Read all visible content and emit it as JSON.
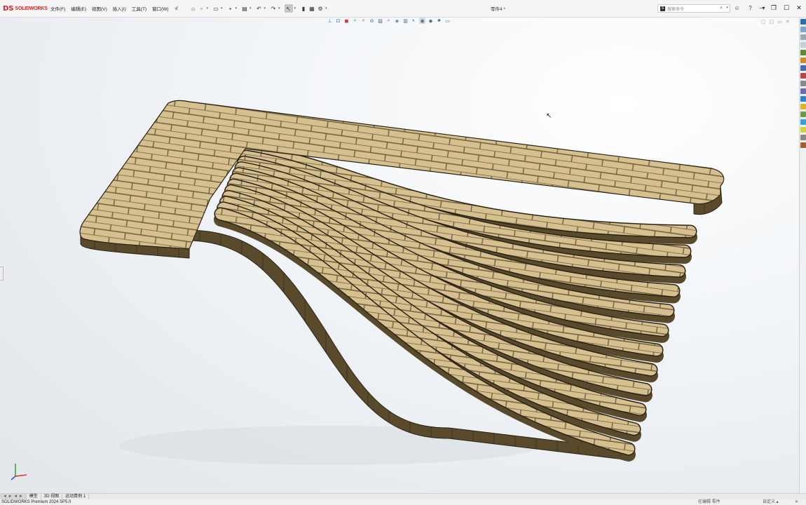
{
  "app": {
    "logo_mark": "DS",
    "logo_text": "SOLIDWORKS",
    "doc_title": "零件4 *"
  },
  "menu": {
    "items": [
      "文件(F)",
      "编辑(E)",
      "视图(V)",
      "插入(I)",
      "工具(T)",
      "窗口(W)"
    ],
    "pin_glyph": "⊀"
  },
  "search": {
    "placeholder": "搜索命令",
    "mag_glyph": "⌕",
    "dd_glyph": "▾",
    "logo_glyph": "S"
  },
  "quick_access": [
    {
      "icon": "home-icon",
      "glyph": "⌂",
      "dd": false
    },
    {
      "icon": "new-document-icon",
      "glyph": "▫",
      "dd": true
    },
    {
      "icon": "open-icon",
      "glyph": "▭",
      "dd": true
    },
    {
      "icon": "save-icon",
      "glyph": "▪",
      "dd": true
    },
    {
      "icon": "print-icon",
      "glyph": "▤",
      "dd": true
    },
    {
      "icon": "undo-icon",
      "glyph": "↶",
      "dd": true
    },
    {
      "icon": "redo-icon",
      "glyph": "↷",
      "dd": true
    },
    {
      "icon": "select-icon",
      "glyph": "↖",
      "dd": true,
      "selected": true
    },
    {
      "icon": "rebuild-icon",
      "glyph": "▮",
      "dd": false
    },
    {
      "icon": "file-properties-icon",
      "glyph": "▦",
      "dd": false
    },
    {
      "icon": "options-icon",
      "glyph": "⚙",
      "dd": true
    }
  ],
  "right_icons": [
    {
      "icon": "user-icon",
      "glyph": "☺"
    },
    {
      "icon": "help-icon",
      "glyph": "?"
    },
    {
      "icon": "help-dropdown-icon",
      "glyph": "▾"
    }
  ],
  "window_controls": [
    {
      "icon": "minimize-icon",
      "glyph": "–"
    },
    {
      "icon": "restore-icon",
      "glyph": "❐"
    },
    {
      "icon": "maximize-icon",
      "glyph": "☐"
    },
    {
      "icon": "close-icon",
      "glyph": "✕"
    }
  ],
  "view_toolbar": [
    {
      "icon": "view-orientation-icon",
      "glyph": "⊥"
    },
    {
      "icon": "zoom-to-fit-icon",
      "glyph": "⊡"
    },
    {
      "icon": "zoom-area-icon",
      "glyph": "◼",
      "color": "#c83a3a"
    },
    {
      "icon": "previous-view-icon",
      "glyph": "⌕"
    },
    {
      "icon": "section-view-icon",
      "glyph": "⌕"
    },
    {
      "icon": "dynamic-annotation-icon",
      "glyph": "⊘"
    },
    {
      "icon": "view-settings-icon",
      "glyph": "▧"
    },
    {
      "icon": "display-style-icon",
      "glyph": "⌕"
    },
    {
      "icon": "hide-show-icon",
      "glyph": "◈"
    },
    {
      "icon": "edit-appearance-icon",
      "glyph": "▥"
    },
    {
      "icon": "apply-scene-icon",
      "glyph": "◐"
    },
    {
      "icon": "view-setting-icon",
      "glyph": "◉",
      "selected": true
    },
    {
      "icon": "render-icon",
      "glyph": "◆"
    },
    {
      "icon": "realview-icon",
      "glyph": "♣"
    },
    {
      "icon": "monitor-icon",
      "glyph": "▭"
    }
  ],
  "viewport_controls": [
    "▢",
    "▢",
    "▭",
    "✕"
  ],
  "task_pane_colors": [
    "#2a6fb0",
    "#7fa3c8",
    "#9aa9b8",
    "#c9ced6",
    "#5c8a3a",
    "#d08a2a",
    "#3f6fb0",
    "#b54747",
    "#8a8a8a",
    "#6a6ab0",
    "#2f7fd0",
    "#e0b030",
    "#6a9a4a",
    "#3aa0d0",
    "#d0d040",
    "#888888",
    "#a06030"
  ],
  "model": {
    "brick_face": "#d6c08f",
    "brick_side": "#5a4a2c",
    "mortar": "#6e5e3c",
    "slat_count": 12
  },
  "bottom_tabs": {
    "nav": "◄ ► ◄ ►",
    "items": [
      "模型",
      "3D 视图",
      "运动算例 1"
    ]
  },
  "status": {
    "left": "SOLIDWORKS Premium 2024 SP5.0",
    "edit_mode": "在编辑 零件",
    "units": "自定义 ▴",
    "close_glyph": "✕"
  },
  "triad": {
    "x_color": "#d93030",
    "y_color": "#30a030",
    "z_color": "#3050c8"
  }
}
